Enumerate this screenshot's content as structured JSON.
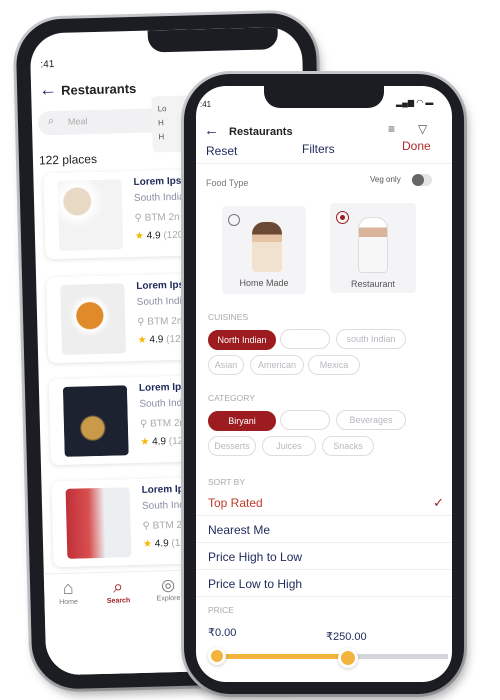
{
  "back_phone": {
    "status_time": ":41",
    "header": {
      "title": "Restaurants",
      "back_icon": "arrow-left-icon",
      "sort_icon": "sort-icon",
      "filter_icon": "filter-icon"
    },
    "search": {
      "placeholder": "Meal"
    },
    "dropdown": [
      "Lo",
      "H",
      "H"
    ],
    "count": "122 places",
    "cards": [
      {
        "name": "Lorem Ips",
        "cuisine": "South India",
        "location": "BTM 2n",
        "rating": "4.9",
        "reviews": "(120"
      },
      {
        "name": "Lorem Ips",
        "cuisine": "South India",
        "location": "BTM 2n",
        "rating": "4.9",
        "reviews": "(120"
      },
      {
        "name": "Lorem Ips",
        "cuisine": "South India",
        "location": "BTM 2n",
        "rating": "4.9",
        "reviews": "(120"
      },
      {
        "name": "Lorem Ips",
        "cuisine": "South India",
        "location": "BTM 2n",
        "rating": "4.9",
        "reviews": "(120"
      }
    ],
    "tabs": [
      {
        "label": "Home",
        "active": false
      },
      {
        "label": "Search",
        "active": true
      },
      {
        "label": "Explore",
        "active": false
      }
    ]
  },
  "front_phone": {
    "status_time": ":41",
    "header": {
      "title": "Restaurants"
    },
    "filter_bar": {
      "reset": "Reset",
      "title": "Filters",
      "done": "Done"
    },
    "food_type": {
      "label": "Food Type",
      "veg_only": "Veg only",
      "veg_only_on": false,
      "options": [
        {
          "label": "Home Made",
          "selected": false
        },
        {
          "label": "Restaurant",
          "selected": true
        }
      ]
    },
    "cuisines": {
      "label": "CUISINES",
      "chips": [
        {
          "label": "North Indian",
          "selected": true
        },
        {
          "label": "",
          "selected": false
        },
        {
          "label": "south Indian",
          "selected": false
        },
        {
          "label": "Asian",
          "selected": false
        },
        {
          "label": "American",
          "selected": false
        },
        {
          "label": "Mexica",
          "selected": false
        }
      ]
    },
    "category": {
      "label": "CATEGORY",
      "chips": [
        {
          "label": "Biryani",
          "selected": true
        },
        {
          "label": "",
          "selected": false
        },
        {
          "label": "Beverages",
          "selected": false
        },
        {
          "label": "Desserts",
          "selected": false
        },
        {
          "label": "Juices",
          "selected": false
        },
        {
          "label": "Snacks",
          "selected": false
        }
      ]
    },
    "sort_by": {
      "label": "SORT BY",
      "options": [
        {
          "label": "Top Rated",
          "selected": true
        },
        {
          "label": "Nearest Me",
          "selected": false
        },
        {
          "label": "Price High to Low",
          "selected": false
        },
        {
          "label": "Price Low to High",
          "selected": false
        }
      ]
    },
    "price": {
      "label": "PRICE",
      "min": "₹0.00",
      "max": "₹250.00"
    }
  },
  "colors": {
    "accent": "#9c1c1f",
    "navy": "#1d2a5a",
    "slider": "#f2b43c",
    "star": "#f5b800"
  }
}
